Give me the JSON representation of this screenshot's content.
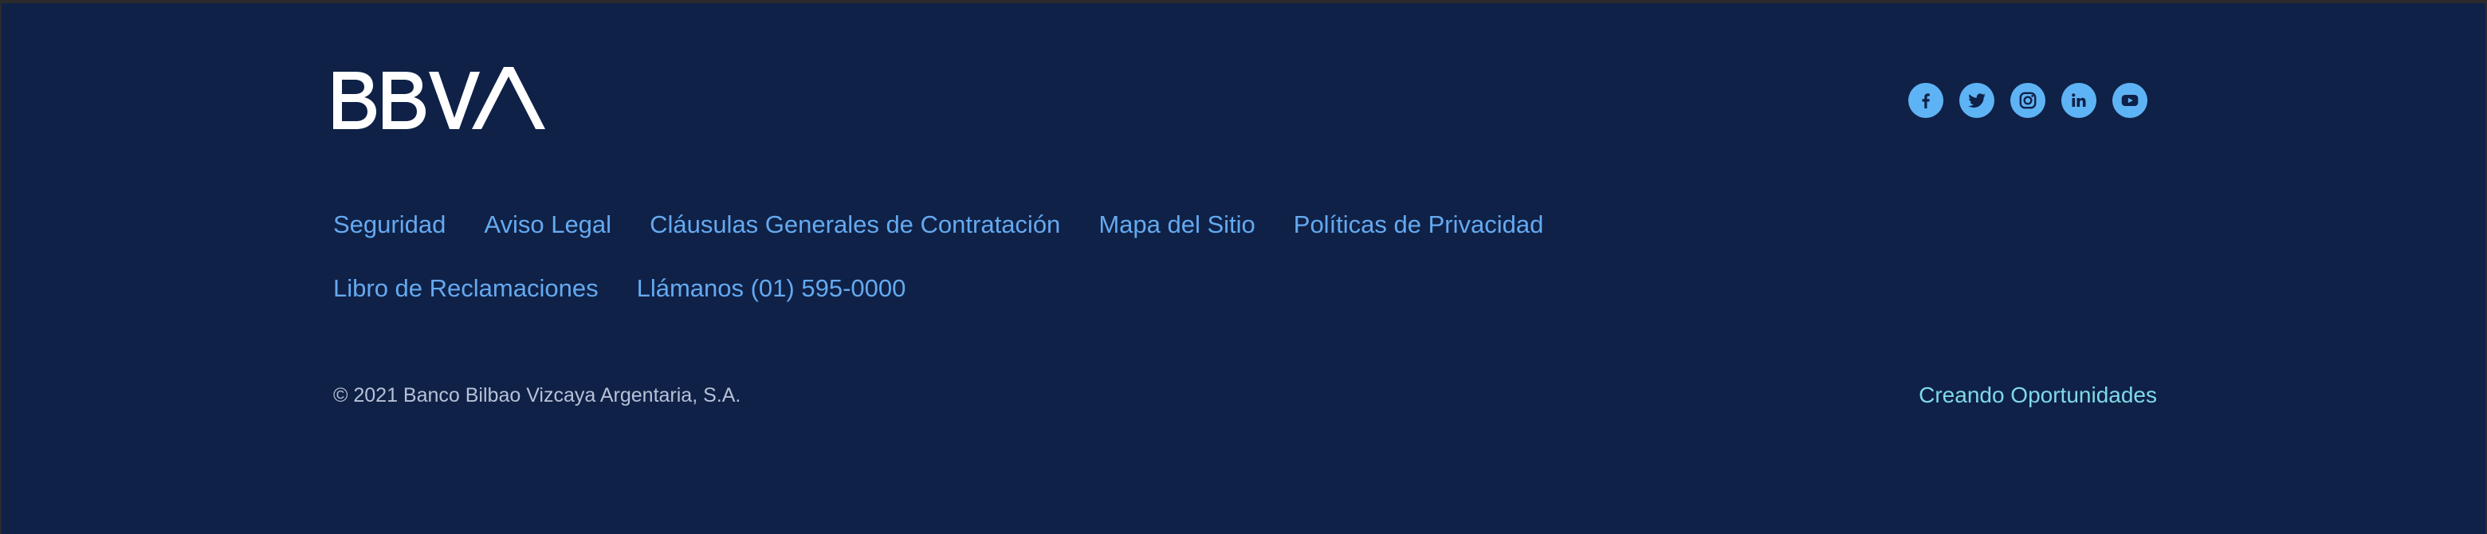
{
  "footer": {
    "logo_text": "BBVA",
    "social": [
      {
        "name": "facebook",
        "icon": "facebook-icon"
      },
      {
        "name": "twitter",
        "icon": "twitter-icon"
      },
      {
        "name": "instagram",
        "icon": "instagram-icon"
      },
      {
        "name": "linkedin",
        "icon": "linkedin-icon"
      },
      {
        "name": "youtube",
        "icon": "youtube-icon"
      }
    ],
    "links_row1": [
      "Seguridad",
      "Aviso Legal",
      "Cláusulas Generales de Contratación",
      "Mapa del Sitio",
      "Políticas de Privacidad"
    ],
    "links_row2": [
      "Libro de Reclamaciones",
      "Llámanos (01) 595-0000"
    ],
    "copyright": "© 2021 Banco Bilbao Vizcaya Argentaria, S.A.",
    "tagline": "Creando Oportunidades",
    "colors": {
      "background": "#0f2147",
      "link": "#65a9ef",
      "social_icon_bg": "#5eb3f5",
      "tagline": "#7fd9e6",
      "copyright": "#b7c1d6"
    }
  }
}
